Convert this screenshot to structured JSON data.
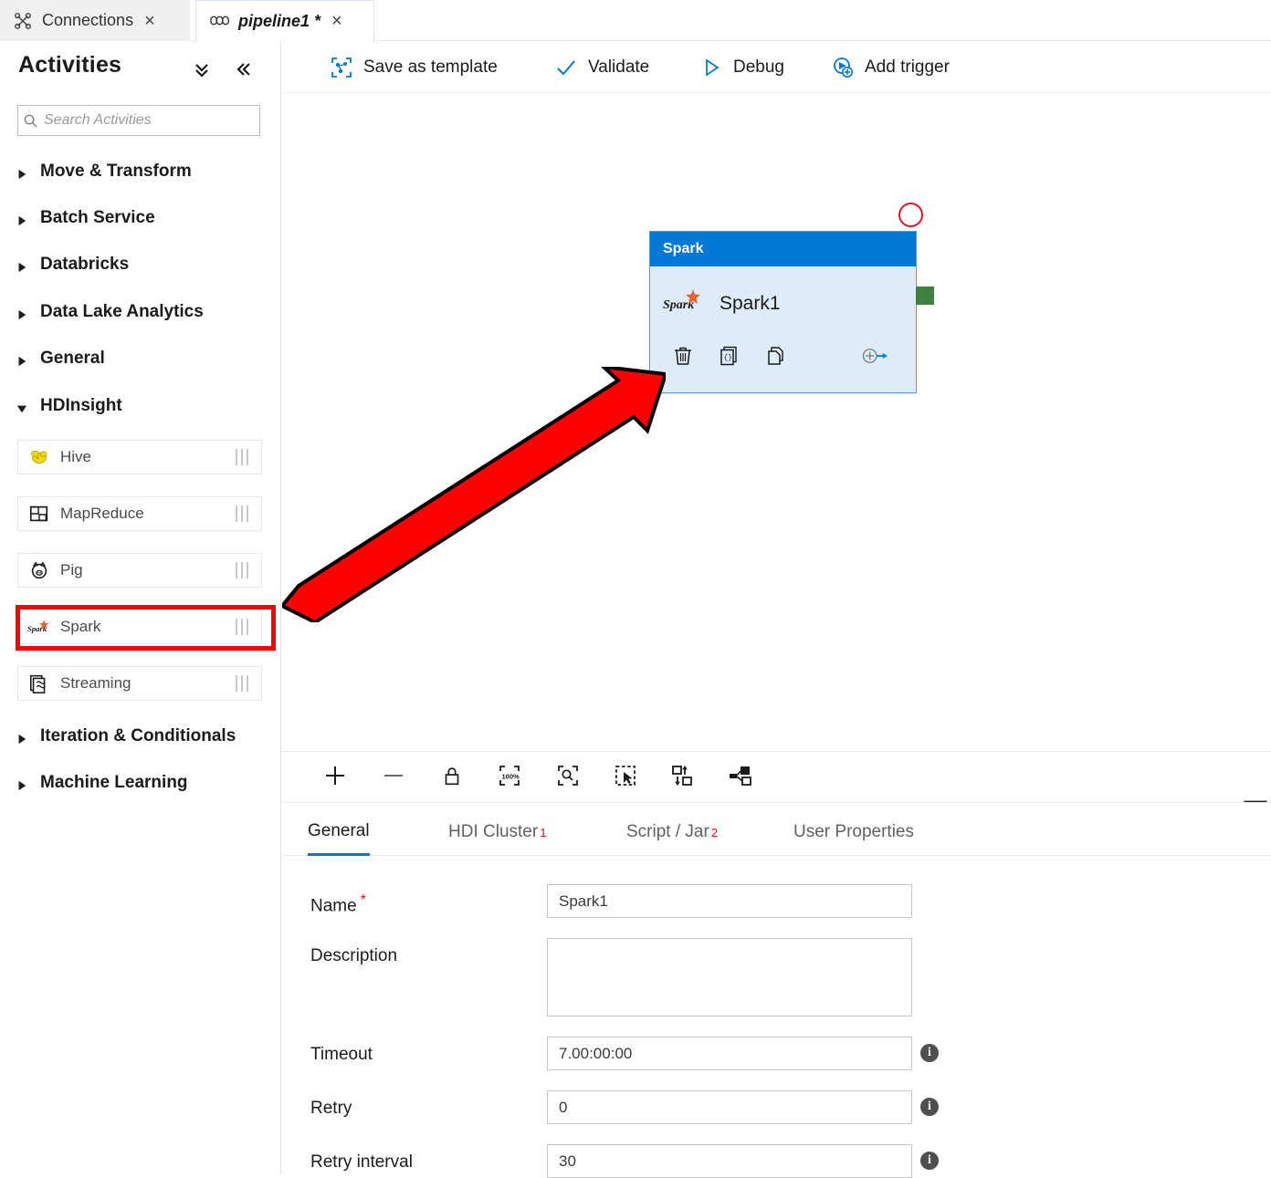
{
  "tabs": [
    {
      "label": "Connections",
      "icon": "connections-icon",
      "close": "×",
      "active": false
    },
    {
      "label": "pipeline1 *",
      "icon": "pipeline-icon",
      "close": "×",
      "active": true
    }
  ],
  "sidebar": {
    "title": "Activities",
    "collapse_all_icon": "chevron-double-down-icon",
    "collapse_panel_icon": "chevron-double-left-icon",
    "search": {
      "placeholder": "Search Activities",
      "value": "",
      "icon": "search-icon"
    },
    "groups": [
      {
        "label": "Move & Transform",
        "expanded": false
      },
      {
        "label": "Batch Service",
        "expanded": false
      },
      {
        "label": "Databricks",
        "expanded": false
      },
      {
        "label": "Data Lake Analytics",
        "expanded": false
      },
      {
        "label": "General",
        "expanded": false
      },
      {
        "label": "HDInsight",
        "expanded": true
      },
      {
        "label": "Iteration & Conditionals",
        "expanded": false
      },
      {
        "label": "Machine Learning",
        "expanded": false
      }
    ],
    "activities": [
      {
        "label": "Hive",
        "icon": "hive-icon"
      },
      {
        "label": "MapReduce",
        "icon": "mapreduce-icon"
      },
      {
        "label": "Pig",
        "icon": "pig-icon"
      },
      {
        "label": "Spark",
        "icon": "spark-icon",
        "highlighted": true
      },
      {
        "label": "Streaming",
        "icon": "streaming-icon"
      }
    ],
    "highlight_color": "#ff0000"
  },
  "command_bar": {
    "save_as_template": {
      "label": "Save as template",
      "icon": "save-as-template-icon"
    },
    "validate": {
      "label": "Validate",
      "icon": "checkmark-icon"
    },
    "debug": {
      "label": "Debug",
      "icon": "play-triangle-icon"
    },
    "add_trigger": {
      "label": "Add trigger",
      "icon": "add-trigger-icon"
    }
  },
  "canvas": {
    "node": {
      "header": "Spark",
      "name": "Spark1",
      "icon": "spark-icon",
      "header_color": "#0078d4",
      "body_color": "#deecf9",
      "border_color": "#5c9bd1",
      "actions": [
        {
          "name": "delete",
          "icon": "trash-icon"
        },
        {
          "name": "code",
          "icon": "code-braces-icon"
        },
        {
          "name": "clone",
          "icon": "copy-icon"
        },
        {
          "name": "add-output",
          "icon": "add-output-arrow-icon"
        }
      ],
      "status_circle_color": "#e81123",
      "output_handle_color": "#3e8142"
    },
    "annotation": {
      "type": "arrow",
      "color": "#ff0000",
      "outline": "#000000",
      "points_from": "Spark activity in sidebar",
      "points_to": "Spark1 node on canvas"
    }
  },
  "canvas_toolbar": [
    {
      "name": "zoom-in",
      "icon": "plus-icon"
    },
    {
      "name": "zoom-out",
      "icon": "minus-icon"
    },
    {
      "name": "lock",
      "icon": "lock-icon"
    },
    {
      "name": "zoom-100",
      "icon": "zoom-100-icon",
      "label": "100%"
    },
    {
      "name": "zoom-to-fit",
      "icon": "zoom-to-fit-icon"
    },
    {
      "name": "select-all",
      "icon": "select-all-icon"
    },
    {
      "name": "auto-align",
      "icon": "auto-align-icon"
    },
    {
      "name": "show-related",
      "icon": "related-nodes-icon"
    }
  ],
  "properties": {
    "tabs": [
      {
        "label": "General",
        "badge": "",
        "active": true
      },
      {
        "label": "HDI Cluster",
        "badge": "1",
        "active": false
      },
      {
        "label": "Script / Jar",
        "badge": "2",
        "active": false
      },
      {
        "label": "User Properties",
        "badge": "",
        "active": false
      }
    ],
    "fields": {
      "name": {
        "label": "Name",
        "required": true,
        "value": "Spark1"
      },
      "description": {
        "label": "Description",
        "value": ""
      },
      "timeout": {
        "label": "Timeout",
        "value": "7.00:00:00",
        "info": "i"
      },
      "retry": {
        "label": "Retry",
        "value": "0",
        "info": "i"
      },
      "retry_interval": {
        "label": "Retry interval",
        "value": "30",
        "info": "i"
      }
    }
  }
}
